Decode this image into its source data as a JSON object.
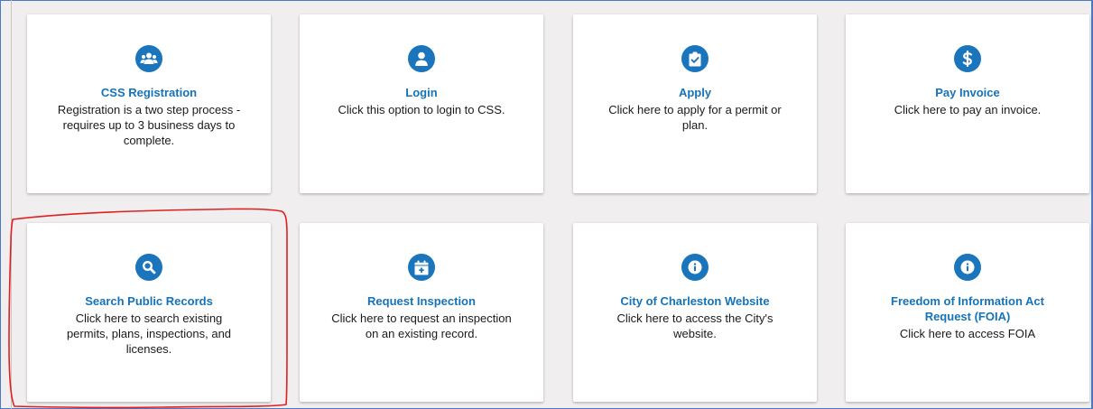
{
  "cards": [
    {
      "title": "CSS Registration",
      "description": "Registration is a two step process - requires up to 3 business days to complete.",
      "icon": "users-icon"
    },
    {
      "title": "Login",
      "description": "Click this option to login to CSS.",
      "icon": "user-icon"
    },
    {
      "title": "Apply",
      "description": "Click here to apply for a permit or plan.",
      "icon": "clipboard-check-icon"
    },
    {
      "title": "Pay Invoice",
      "description": "Click here to pay an invoice.",
      "icon": "dollar-icon"
    },
    {
      "title": "Search Public Records",
      "description": "Click here to search existing permits, plans, inspections, and licenses.",
      "icon": "search-icon"
    },
    {
      "title": "Request Inspection",
      "description": "Click here to request an inspection on an existing record.",
      "icon": "calendar-plus-icon"
    },
    {
      "title": "City of Charleston Website",
      "description": "Click here to access the City's website.",
      "icon": "info-icon"
    },
    {
      "title": "Freedom of Information Act Request (FOIA)",
      "description": "Click here to access FOIA",
      "icon": "info-icon"
    }
  ],
  "colors": {
    "accent": "#1b75bc",
    "title": "#1673b8",
    "background": "#f0eeee",
    "annotation": "#e02020"
  }
}
